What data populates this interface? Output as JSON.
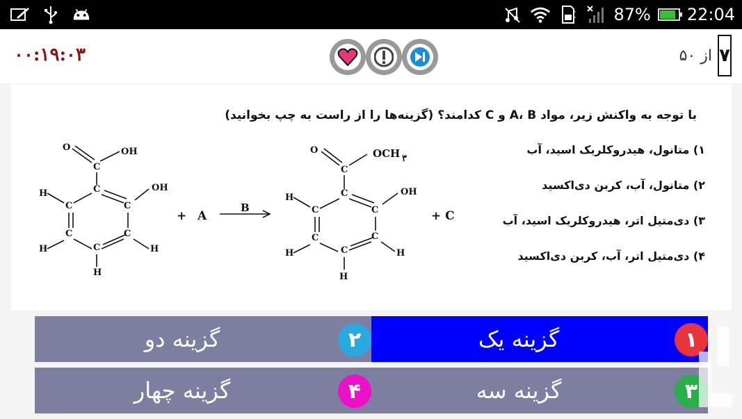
{
  "status_bar": {
    "battery": "87%",
    "battery_level": 0.87,
    "time": "22:04",
    "icons_left": [
      "edit-icon",
      "usb-icon",
      "android-icon"
    ],
    "icons_right": [
      "silent-icon",
      "wifi-icon",
      "sd-card-icon",
      "signal-icon",
      "battery-icon"
    ]
  },
  "header": {
    "timer": "۰۰:۱۹:۰۳",
    "question_number": "۷",
    "question_total_text": "از ۵۰",
    "buttons": [
      "heart-button",
      "alert-button",
      "next-button"
    ]
  },
  "question": {
    "stem": "با توجه به واکنش زیر، مواد A، B و C کدامند؟ (گزینه‌ها را از راست به چپ بخوانید)",
    "options": [
      "۱) متانول، هیدروکلریک اسید، آب",
      "۲) متانول، آب، کربن دی‌اکسید",
      "۳) دی‌متیل اتر، هیدروکلریک اسید، آب",
      "۴) دی‌متیل اتر، آب، کربن دی‌اکسید"
    ],
    "reaction": {
      "plus": "+",
      "reagent_a": "A",
      "arrow_label": "B",
      "product_c": "+ C",
      "r_oh": "OH",
      "r_o": "O",
      "p_och3": "OCH",
      "p_sub": "۳",
      "atom_c": "C",
      "atom_h": "H"
    }
  },
  "answers": [
    {
      "num": "۱",
      "label": "گزینه یک",
      "badge_color": "#e8343c",
      "selected": true
    },
    {
      "num": "۲",
      "label": "گزینه دو",
      "badge_color": "#29a9e0",
      "selected": false
    },
    {
      "num": "۳",
      "label": "گزینه سه",
      "badge_color": "#2aae4a",
      "selected": false
    },
    {
      "num": "۴",
      "label": "گزینه چهار",
      "badge_color": "#ee10c8",
      "selected": false
    }
  ],
  "colors": {
    "selected_answer": "#0000ff",
    "answer_bg": "#7d7ea0",
    "timer": "#8b1010"
  }
}
